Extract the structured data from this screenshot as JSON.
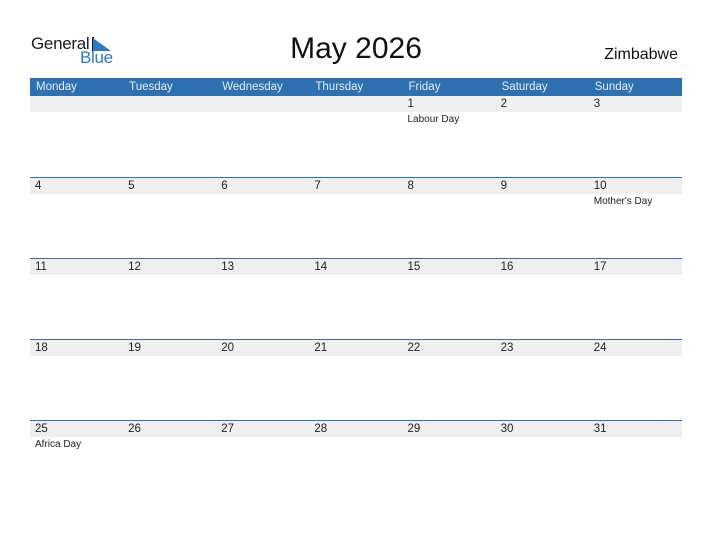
{
  "logo": {
    "line1": "General",
    "line2": "Blue",
    "brand_color": "#2f78c4"
  },
  "title": "May 2026",
  "country": "Zimbabwe",
  "colors": {
    "header_bg": "#2e70b0",
    "date_strip_bg": "#efefef",
    "week_border": "#2e70b0"
  },
  "weekdays": [
    "Monday",
    "Tuesday",
    "Wednesday",
    "Thursday",
    "Friday",
    "Saturday",
    "Sunday"
  ],
  "weeks": [
    [
      {
        "day": "",
        "holiday": ""
      },
      {
        "day": "",
        "holiday": ""
      },
      {
        "day": "",
        "holiday": ""
      },
      {
        "day": "",
        "holiday": ""
      },
      {
        "day": "1",
        "holiday": "Labour Day"
      },
      {
        "day": "2",
        "holiday": ""
      },
      {
        "day": "3",
        "holiday": ""
      }
    ],
    [
      {
        "day": "4",
        "holiday": ""
      },
      {
        "day": "5",
        "holiday": ""
      },
      {
        "day": "6",
        "holiday": ""
      },
      {
        "day": "7",
        "holiday": ""
      },
      {
        "day": "8",
        "holiday": ""
      },
      {
        "day": "9",
        "holiday": ""
      },
      {
        "day": "10",
        "holiday": "Mother's Day"
      }
    ],
    [
      {
        "day": "11",
        "holiday": ""
      },
      {
        "day": "12",
        "holiday": ""
      },
      {
        "day": "13",
        "holiday": ""
      },
      {
        "day": "14",
        "holiday": ""
      },
      {
        "day": "15",
        "holiday": ""
      },
      {
        "day": "16",
        "holiday": ""
      },
      {
        "day": "17",
        "holiday": ""
      }
    ],
    [
      {
        "day": "18",
        "holiday": ""
      },
      {
        "day": "19",
        "holiday": ""
      },
      {
        "day": "20",
        "holiday": ""
      },
      {
        "day": "21",
        "holiday": ""
      },
      {
        "day": "22",
        "holiday": ""
      },
      {
        "day": "23",
        "holiday": ""
      },
      {
        "day": "24",
        "holiday": ""
      }
    ],
    [
      {
        "day": "25",
        "holiday": "Africa Day"
      },
      {
        "day": "26",
        "holiday": ""
      },
      {
        "day": "27",
        "holiday": ""
      },
      {
        "day": "28",
        "holiday": ""
      },
      {
        "day": "29",
        "holiday": ""
      },
      {
        "day": "30",
        "holiday": ""
      },
      {
        "day": "31",
        "holiday": ""
      }
    ]
  ]
}
